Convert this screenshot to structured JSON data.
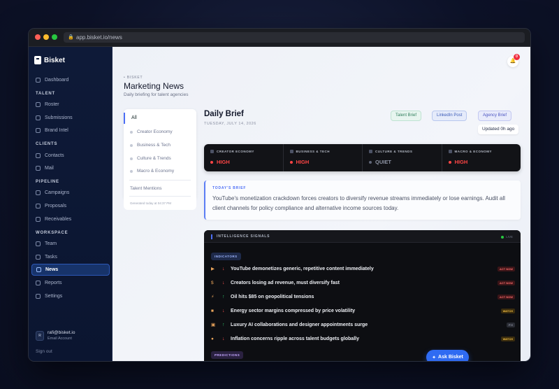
{
  "browser": {
    "url": "app.bisket.io/news"
  },
  "brand": {
    "name": "Bisket"
  },
  "sidebar": {
    "dashboard": "Dashboard",
    "sections": {
      "talent": "TALENT",
      "clients": "CLIENTS",
      "pipeline": "PIPELINE",
      "workspace": "WORKSPACE"
    },
    "items": {
      "roster": "Roster",
      "submissions": "Submissions",
      "brand_intel": "Brand Intel",
      "contacts": "Contacts",
      "mail": "Mail",
      "campaigns": "Campaigns",
      "proposals": "Proposals",
      "receivables": "Receivables",
      "team": "Team",
      "tasks": "Tasks",
      "news": "News",
      "reports": "Reports",
      "settings": "Settings"
    },
    "user": {
      "avatar": "R",
      "email": "rafi@bisket.io",
      "type": "Email Account"
    },
    "signout": "Sign out"
  },
  "header": {
    "notification_count": "0",
    "eyebrow": "• BISKET",
    "title": "Marketing News",
    "subtitle": "Daily briefing for talent agencies"
  },
  "filters": {
    "all": "All",
    "items": [
      "Creator Economy",
      "Business & Tech",
      "Culture & Trends",
      "Macro & Economy"
    ],
    "talent_mentions": "Talent Mentions",
    "generated": "Generated today at 04:37 PM"
  },
  "brief": {
    "title": "Daily Brief",
    "date": "TUESDAY, JULY 14, 2026",
    "buttons": {
      "talent": "Talent Brief",
      "linkedin": "LinkedIn Post",
      "agency": "Agency Brief"
    },
    "updated": "Updated 0h ago"
  },
  "metrics": [
    {
      "label": "CREATOR ECONOMY",
      "value": "HIGH"
    },
    {
      "label": "BUSINESS & TECH",
      "value": "HIGH"
    },
    {
      "label": "CULTURE & TRENDS",
      "value": "QUIET"
    },
    {
      "label": "MACRO & ECONOMY",
      "value": "HIGH"
    }
  ],
  "today": {
    "label": "TODAY'S BRIEF",
    "text": "YouTube's monetization crackdown forces creators to diversify revenue streams immediately or lose earnings. Audit all client channels for policy compliance and alternative income sources today."
  },
  "signals": {
    "title": "INTELLIGENCE SIGNALS",
    "live": "LIVE",
    "indicators_tag": "INDICATORS",
    "predictions_tag": "PREDICTIONS",
    "rows": [
      {
        "text": "YouTube demonetizes generic, repetitive content immediately",
        "badge": "ACT NOW"
      },
      {
        "text": "Creators losing ad revenue, must diversify fast",
        "badge": "ACT NOW"
      },
      {
        "text": "Oil hits $85 on geopolitical tensions",
        "badge": "ACT NOW"
      },
      {
        "text": "Energy sector margins compressed by price volatility",
        "badge": "WATCH"
      },
      {
        "text": "Luxury AI collaborations and designer appointments surge",
        "badge": "FYI"
      },
      {
        "text": "Inflation concerns ripple across talent budgets globally",
        "badge": "WATCH"
      }
    ]
  },
  "ask": {
    "label": "Ask Bisket"
  },
  "colors": {
    "accent": "#2f6bf2",
    "high": "#ff4545",
    "active_nav": "#17336a"
  }
}
